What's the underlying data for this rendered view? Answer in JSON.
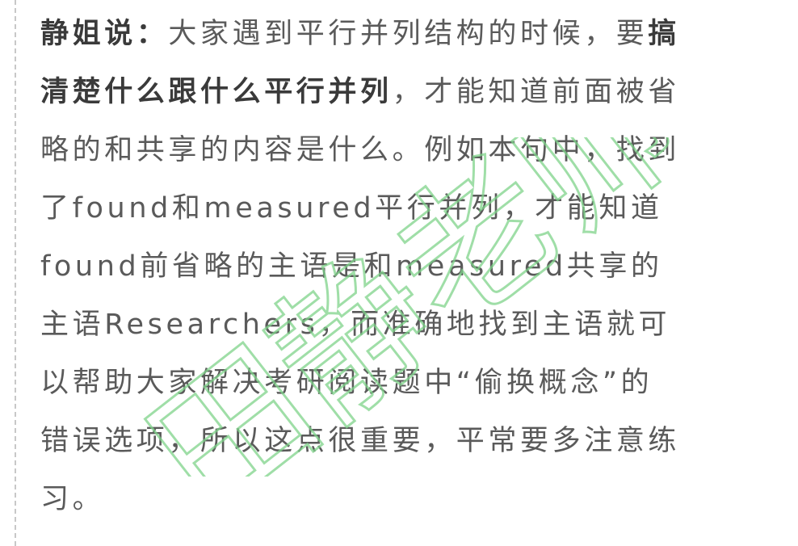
{
  "note": {
    "label": "静姐说：",
    "lines": [
      {
        "segments": [
          {
            "text": "大家遇到平行并列结构的时候，要",
            "bold": false
          },
          {
            "text": "搞",
            "bold": true
          }
        ]
      },
      {
        "segments": [
          {
            "text": "清楚什么跟什么平行并列",
            "bold": true
          },
          {
            "text": "，才能知道前面被省",
            "bold": false
          }
        ]
      },
      {
        "segments": [
          {
            "text": "略的和共享的内容是什么。例如本句中，找到",
            "bold": false
          }
        ]
      },
      {
        "segments": [
          {
            "text": "了found和measured平行并列，才能知道",
            "bold": false
          }
        ]
      },
      {
        "segments": [
          {
            "text": "found前省略的主语是和measured共享的",
            "bold": false
          }
        ]
      },
      {
        "segments": [
          {
            "text": "主语Researchers，而准确地找到主语就可",
            "bold": false
          }
        ]
      },
      {
        "segments": [
          {
            "text": "以帮助大家解决考研阅读题中“偷换概念”的",
            "bold": false
          }
        ]
      },
      {
        "segments": [
          {
            "text": "错误选项，所以这点很重要，平常要多注意练",
            "bold": false
          }
        ]
      },
      {
        "segments": [
          {
            "text": "习。",
            "bold": false
          }
        ]
      }
    ]
  },
  "watermark": {
    "text": "田静老师",
    "color": "#7fd38a"
  }
}
